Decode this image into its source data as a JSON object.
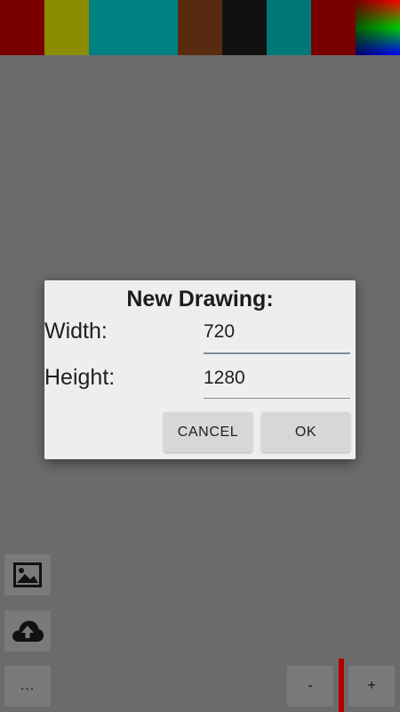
{
  "palette": {
    "colors": [
      "#7a0000",
      "#8c8c00",
      "#008080",
      "#5a2a10",
      "#111111",
      "#007878",
      "#7a0000"
    ],
    "gradient_swatch": "rgb-gradient"
  },
  "dialog": {
    "title": "New Drawing:",
    "width_label": "Width:",
    "width_value": "720",
    "height_label": "Height:",
    "height_value": "1280",
    "cancel_label": "CANCEL",
    "ok_label": "OK",
    "focused_underline_color": "#7a8f98",
    "underline_color": "#8a8a8a"
  },
  "tools": {
    "image_icon": "image-icon",
    "cloud_icon": "cloud-upload-icon",
    "more_label": "..."
  },
  "size_controls": {
    "minus_label": "-",
    "plus_label": "+",
    "indicator_color": "#b10000"
  }
}
